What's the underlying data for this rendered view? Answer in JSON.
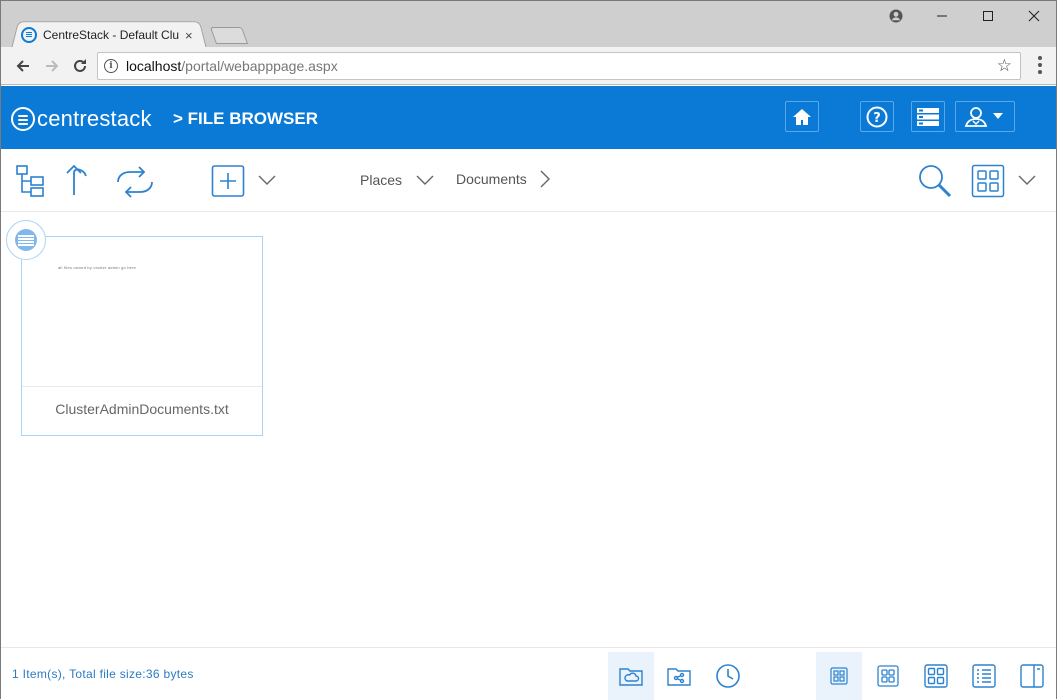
{
  "browser": {
    "tab_title": "CentreStack - Default Clu",
    "tab_close": "×",
    "url_host": "localhost",
    "url_path": "/portal/webapppage.aspx",
    "window_controls": [
      "profile-icon",
      "minimize-icon",
      "maximize-icon",
      "close-icon"
    ]
  },
  "app": {
    "logo_prefix": "centre",
    "logo_suffix": "stack",
    "page_title": "> FILE BROWSER",
    "brand_color": "#0a7ad6",
    "header_buttons": [
      "home-icon",
      "help-icon",
      "storage-icon",
      "user-menu-icon"
    ]
  },
  "file_toolbar": {
    "places_label": "Places",
    "documents_label": "Documents",
    "icons": [
      "tree-view-icon",
      "up-folder-icon",
      "refresh-icon",
      "add-icon",
      "search-icon",
      "view-mode-icon"
    ]
  },
  "files": [
    {
      "name": "ClusterAdminDocuments.txt",
      "preview": "all files owned by cluster admin go here"
    }
  ],
  "footer": {
    "status": "1 Item(s), Total file size:36 bytes",
    "nav_icons": [
      "cloud-folder-icon",
      "shared-folder-icon",
      "recent-icon"
    ],
    "view_icons": [
      "small-thumbnail-icon",
      "medium-thumbnail-icon",
      "large-thumbnail-icon",
      "detail-list-icon",
      "preview-pane-icon"
    ]
  }
}
